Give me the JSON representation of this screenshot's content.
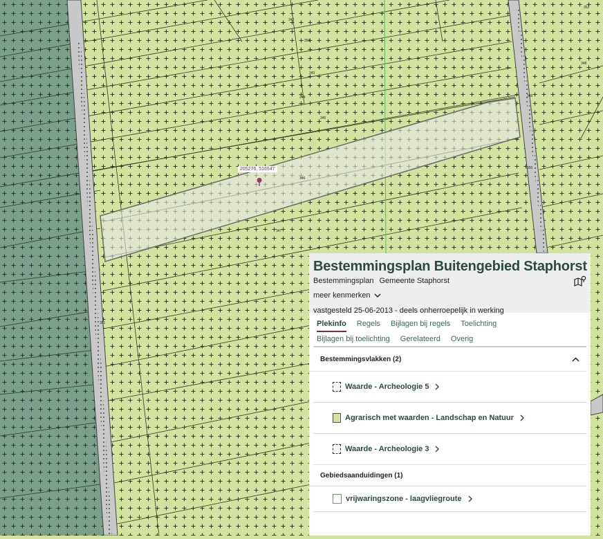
{
  "map": {
    "coordinate_label": "205276, 516547",
    "colors": {
      "agricultural": "#d2e3a0",
      "dark_zone": "#7b9f8a",
      "road": "#c8c8c8",
      "selection": "#e6e6e6"
    },
    "parcel_numbers": [
      "342",
      "343",
      "344",
      "345",
      "346",
      "347",
      "348",
      "349",
      "350",
      "351",
      "352",
      "353"
    ]
  },
  "panel": {
    "title": "Bestemmingsplan Buitengebied Staphorst",
    "type": "Bestemmingsplan",
    "municipality": "Gemeente Staphorst",
    "more_label": "meer kenmerken",
    "status": "vastgesteld 25-06-2013 - deels onherroepelijk in werking",
    "tabs": [
      {
        "label": "Plekinfo",
        "active": true
      },
      {
        "label": "Regels"
      },
      {
        "label": "Bijlagen bij regels"
      },
      {
        "label": "Toelichting"
      },
      {
        "label": "Bijlagen bij toelichting"
      },
      {
        "label": "Gerelateerd"
      },
      {
        "label": "Overig"
      }
    ],
    "section1": {
      "title": "Bestemmingsvlakken (2)",
      "items": [
        {
          "label": "Waarde - Archeologie 5",
          "swatch": "archeologie"
        },
        {
          "label": "Agrarisch met waarden - Landschap en Natuur",
          "swatch": "agrarisch"
        },
        {
          "label": "Waarde - Archeologie 3",
          "swatch": "archeologie"
        }
      ]
    },
    "section2": {
      "title": "Gebiedsaanduidingen (1)",
      "items": [
        {
          "label": "vrijwaringszone - laagvliegroute",
          "swatch": "vrijwaring"
        }
      ]
    }
  }
}
